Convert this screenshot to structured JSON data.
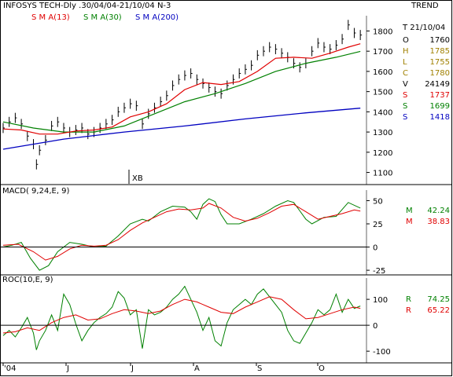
{
  "header": {
    "title": "INFOSYS TECH-Dly .30/04/04-21/10/04  N-3",
    "mode": "TREND"
  },
  "legend_ma": [
    {
      "label": "S M A(13)",
      "color": "#e00000"
    },
    {
      "label": "S M A(30)",
      "color": "#008000"
    },
    {
      "label": "S M A(200)",
      "color": "#0000c0"
    }
  ],
  "colors": {
    "price": "#000000",
    "sma13": "#e00000",
    "sma30": "#008000",
    "sma200": "#0000c0",
    "macd": "#008000",
    "signal": "#e00000"
  },
  "info": {
    "date": "T 21/10/04",
    "rows": [
      {
        "k": "O",
        "v": "1760",
        "color": "#000000"
      },
      {
        "k": "H",
        "v": "1785",
        "color": "#a08000"
      },
      {
        "k": "L",
        "v": "1755",
        "color": "#a08000"
      },
      {
        "k": "C",
        "v": "1780",
        "color": "#a08000"
      },
      {
        "k": "V",
        "v": "24149",
        "color": "#000000"
      },
      {
        "k": "S",
        "v": "1737",
        "color": "#e00000"
      },
      {
        "k": "S",
        "v": "1699",
        "color": "#008000"
      },
      {
        "k": "S",
        "v": "1418",
        "color": "#0000c0"
      }
    ]
  },
  "annotation": "XB",
  "macd_panel": {
    "label": "MACD( 9,24,E, 9)",
    "readouts": [
      {
        "k": "M",
        "v": "42.24",
        "color": "#008000"
      },
      {
        "k": "M",
        "v": "38.83",
        "color": "#e00000"
      }
    ]
  },
  "roc_panel": {
    "label": "ROC(10,E, 9)",
    "readouts": [
      {
        "k": "R",
        "v": "74.25",
        "color": "#008000"
      },
      {
        "k": "R",
        "v": "65.22",
        "color": "#e00000"
      }
    ]
  },
  "chart_data": {
    "type": "line",
    "x_ticks": [
      "'04",
      "J",
      "J",
      "A",
      "S",
      "O"
    ],
    "price": {
      "y_ticks": [
        1100,
        1200,
        1300,
        1400,
        1500,
        1600,
        1700,
        1800
      ],
      "ylim": [
        1040,
        1860
      ],
      "xlim": [
        0,
        119
      ],
      "close": [
        [
          0,
          1320
        ],
        [
          2,
          1350
        ],
        [
          4,
          1370
        ],
        [
          6,
          1340
        ],
        [
          8,
          1280
        ],
        [
          10,
          1240
        ],
        [
          11,
          1140
        ],
        [
          12,
          1210
        ],
        [
          14,
          1260
        ],
        [
          16,
          1330
        ],
        [
          18,
          1350
        ],
        [
          20,
          1320
        ],
        [
          22,
          1300
        ],
        [
          24,
          1310
        ],
        [
          26,
          1320
        ],
        [
          28,
          1290
        ],
        [
          30,
          1300
        ],
        [
          32,
          1320
        ],
        [
          34,
          1340
        ],
        [
          36,
          1360
        ],
        [
          38,
          1400
        ],
        [
          40,
          1420
        ],
        [
          42,
          1440
        ],
        [
          44,
          1430
        ],
        [
          46,
          1340
        ],
        [
          48,
          1390
        ],
        [
          50,
          1420
        ],
        [
          52,
          1450
        ],
        [
          54,
          1480
        ],
        [
          56,
          1530
        ],
        [
          58,
          1560
        ],
        [
          60,
          1580
        ],
        [
          62,
          1590
        ],
        [
          64,
          1560
        ],
        [
          66,
          1540
        ],
        [
          68,
          1520
        ],
        [
          70,
          1500
        ],
        [
          72,
          1490
        ],
        [
          74,
          1530
        ],
        [
          76,
          1560
        ],
        [
          78,
          1590
        ],
        [
          80,
          1610
        ],
        [
          82,
          1630
        ],
        [
          84,
          1680
        ],
        [
          86,
          1700
        ],
        [
          88,
          1720
        ],
        [
          90,
          1710
        ],
        [
          92,
          1690
        ],
        [
          94,
          1670
        ],
        [
          96,
          1640
        ],
        [
          98,
          1620
        ],
        [
          100,
          1640
        ],
        [
          102,
          1700
        ],
        [
          104,
          1740
        ],
        [
          106,
          1720
        ],
        [
          108,
          1710
        ],
        [
          110,
          1730
        ],
        [
          112,
          1760
        ],
        [
          114,
          1830
        ],
        [
          116,
          1790
        ],
        [
          118,
          1780
        ]
      ],
      "sma13": [
        [
          0,
          1315
        ],
        [
          6,
          1310
        ],
        [
          12,
          1290
        ],
        [
          18,
          1290
        ],
        [
          24,
          1305
        ],
        [
          30,
          1310
        ],
        [
          36,
          1325
        ],
        [
          42,
          1375
        ],
        [
          48,
          1400
        ],
        [
          54,
          1440
        ],
        [
          60,
          1510
        ],
        [
          66,
          1545
        ],
        [
          72,
          1535
        ],
        [
          78,
          1550
        ],
        [
          84,
          1600
        ],
        [
          90,
          1665
        ],
        [
          96,
          1670
        ],
        [
          102,
          1665
        ],
        [
          108,
          1690
        ],
        [
          114,
          1720
        ],
        [
          118,
          1737
        ]
      ],
      "sma30": [
        [
          0,
          1350
        ],
        [
          10,
          1320
        ],
        [
          20,
          1300
        ],
        [
          30,
          1300
        ],
        [
          40,
          1330
        ],
        [
          50,
          1390
        ],
        [
          60,
          1450
        ],
        [
          70,
          1490
        ],
        [
          80,
          1540
        ],
        [
          90,
          1600
        ],
        [
          100,
          1640
        ],
        [
          110,
          1670
        ],
        [
          118,
          1699
        ]
      ],
      "sma200": [
        [
          0,
          1215
        ],
        [
          20,
          1265
        ],
        [
          40,
          1300
        ],
        [
          60,
          1330
        ],
        [
          80,
          1365
        ],
        [
          100,
          1395
        ],
        [
          118,
          1418
        ]
      ]
    },
    "macd": {
      "y_ticks": [
        -25,
        0,
        25,
        50
      ],
      "ylim": [
        -30,
        58
      ],
      "xlim": [
        0,
        119
      ],
      "macd": [
        [
          0,
          0
        ],
        [
          3,
          2
        ],
        [
          6,
          5
        ],
        [
          9,
          -12
        ],
        [
          12,
          -25
        ],
        [
          15,
          -20
        ],
        [
          18,
          -5
        ],
        [
          22,
          5
        ],
        [
          26,
          3
        ],
        [
          30,
          0
        ],
        [
          34,
          1
        ],
        [
          38,
          12
        ],
        [
          42,
          25
        ],
        [
          46,
          30
        ],
        [
          48,
          28
        ],
        [
          52,
          38
        ],
        [
          56,
          44
        ],
        [
          60,
          43
        ],
        [
          62,
          38
        ],
        [
          64,
          30
        ],
        [
          66,
          46
        ],
        [
          68,
          52
        ],
        [
          70,
          49
        ],
        [
          72,
          35
        ],
        [
          74,
          25
        ],
        [
          78,
          25
        ],
        [
          82,
          30
        ],
        [
          86,
          36
        ],
        [
          90,
          44
        ],
        [
          94,
          50
        ],
        [
          96,
          48
        ],
        [
          100,
          30
        ],
        [
          102,
          25
        ],
        [
          106,
          32
        ],
        [
          110,
          33
        ],
        [
          114,
          48
        ],
        [
          118,
          42
        ]
      ],
      "signal": [
        [
          0,
          2
        ],
        [
          5,
          3
        ],
        [
          10,
          -5
        ],
        [
          14,
          -14
        ],
        [
          18,
          -10
        ],
        [
          22,
          -2
        ],
        [
          26,
          2
        ],
        [
          30,
          1
        ],
        [
          34,
          2
        ],
        [
          38,
          8
        ],
        [
          42,
          18
        ],
        [
          46,
          26
        ],
        [
          50,
          32
        ],
        [
          54,
          38
        ],
        [
          58,
          41
        ],
        [
          62,
          40
        ],
        [
          66,
          42
        ],
        [
          68,
          47
        ],
        [
          72,
          42
        ],
        [
          76,
          32
        ],
        [
          80,
          28
        ],
        [
          84,
          31
        ],
        [
          88,
          37
        ],
        [
          92,
          44
        ],
        [
          96,
          46
        ],
        [
          100,
          38
        ],
        [
          104,
          30
        ],
        [
          108,
          33
        ],
        [
          112,
          36
        ],
        [
          116,
          40
        ],
        [
          118,
          38.83
        ]
      ]
    },
    "roc": {
      "y_ticks": [
        -100,
        0,
        100
      ],
      "ylim": [
        -145,
        170
      ],
      "xlim": [
        0,
        119
      ],
      "roc": [
        [
          0,
          -40
        ],
        [
          2,
          -20
        ],
        [
          4,
          -45
        ],
        [
          6,
          -10
        ],
        [
          8,
          30
        ],
        [
          10,
          -30
        ],
        [
          11,
          -95
        ],
        [
          12,
          -60
        ],
        [
          14,
          -20
        ],
        [
          16,
          40
        ],
        [
          18,
          -20
        ],
        [
          20,
          120
        ],
        [
          22,
          80
        ],
        [
          24,
          5
        ],
        [
          26,
          -60
        ],
        [
          28,
          -20
        ],
        [
          30,
          10
        ],
        [
          32,
          30
        ],
        [
          34,
          45
        ],
        [
          36,
          70
        ],
        [
          38,
          130
        ],
        [
          40,
          105
        ],
        [
          42,
          40
        ],
        [
          44,
          60
        ],
        [
          46,
          -90
        ],
        [
          48,
          60
        ],
        [
          50,
          40
        ],
        [
          52,
          50
        ],
        [
          54,
          70
        ],
        [
          56,
          100
        ],
        [
          58,
          120
        ],
        [
          60,
          150
        ],
        [
          62,
          100
        ],
        [
          64,
          50
        ],
        [
          66,
          -20
        ],
        [
          68,
          30
        ],
        [
          70,
          -60
        ],
        [
          72,
          -80
        ],
        [
          74,
          10
        ],
        [
          76,
          60
        ],
        [
          78,
          80
        ],
        [
          80,
          100
        ],
        [
          82,
          80
        ],
        [
          84,
          120
        ],
        [
          86,
          140
        ],
        [
          88,
          110
        ],
        [
          90,
          80
        ],
        [
          92,
          50
        ],
        [
          94,
          -20
        ],
        [
          96,
          -60
        ],
        [
          98,
          -70
        ],
        [
          100,
          -30
        ],
        [
          102,
          10
        ],
        [
          104,
          60
        ],
        [
          106,
          40
        ],
        [
          108,
          60
        ],
        [
          110,
          120
        ],
        [
          112,
          50
        ],
        [
          114,
          100
        ],
        [
          116,
          65
        ],
        [
          118,
          74.25
        ]
      ],
      "signal": [
        [
          0,
          -30
        ],
        [
          4,
          -25
        ],
        [
          8,
          -10
        ],
        [
          12,
          -20
        ],
        [
          16,
          10
        ],
        [
          20,
          30
        ],
        [
          24,
          40
        ],
        [
          28,
          20
        ],
        [
          32,
          25
        ],
        [
          36,
          45
        ],
        [
          40,
          60
        ],
        [
          44,
          55
        ],
        [
          48,
          45
        ],
        [
          52,
          55
        ],
        [
          56,
          80
        ],
        [
          60,
          100
        ],
        [
          64,
          90
        ],
        [
          68,
          70
        ],
        [
          72,
          50
        ],
        [
          76,
          45
        ],
        [
          80,
          70
        ],
        [
          84,
          90
        ],
        [
          88,
          110
        ],
        [
          92,
          100
        ],
        [
          96,
          60
        ],
        [
          100,
          25
        ],
        [
          104,
          30
        ],
        [
          108,
          45
        ],
        [
          112,
          60
        ],
        [
          116,
          70
        ],
        [
          118,
          65.22
        ]
      ]
    }
  }
}
